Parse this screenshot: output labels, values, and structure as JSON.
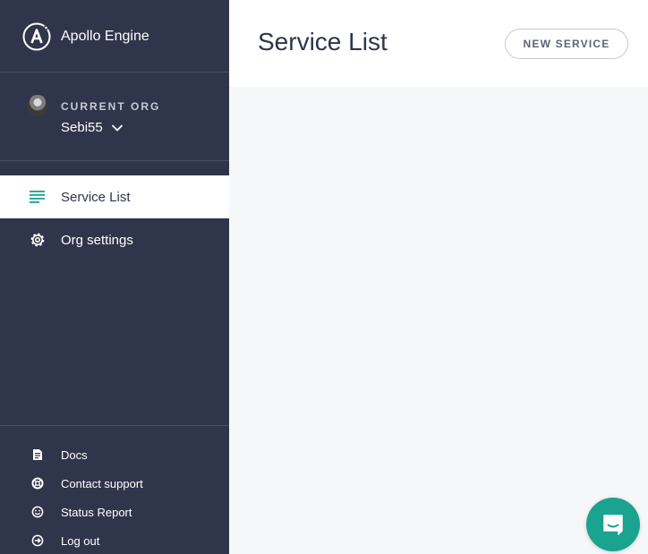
{
  "brand": {
    "name": "Apollo Engine",
    "icon": "apollo-logo-icon"
  },
  "org": {
    "caption": "CURRENT ORG",
    "name": "Sebi55",
    "icon": "chevron-down-icon"
  },
  "nav": {
    "items": [
      {
        "label": "Service List",
        "icon": "list-icon",
        "active": true
      },
      {
        "label": "Org settings",
        "icon": "gear-icon",
        "active": false
      }
    ]
  },
  "footer": {
    "items": [
      {
        "label": "Docs",
        "icon": "document-icon"
      },
      {
        "label": "Contact support",
        "icon": "lifebuoy-icon"
      },
      {
        "label": "Status Report",
        "icon": "smiley-icon"
      },
      {
        "label": "Log out",
        "icon": "logout-icon"
      }
    ]
  },
  "header": {
    "title": "Service List",
    "new_service_label": "NEW SERVICE"
  },
  "chat": {
    "icon": "chat-icon"
  },
  "colors": {
    "sidebar_bg": "#2f354a",
    "accent": "#1aa38e",
    "content_bg": "#f6f7f9"
  }
}
